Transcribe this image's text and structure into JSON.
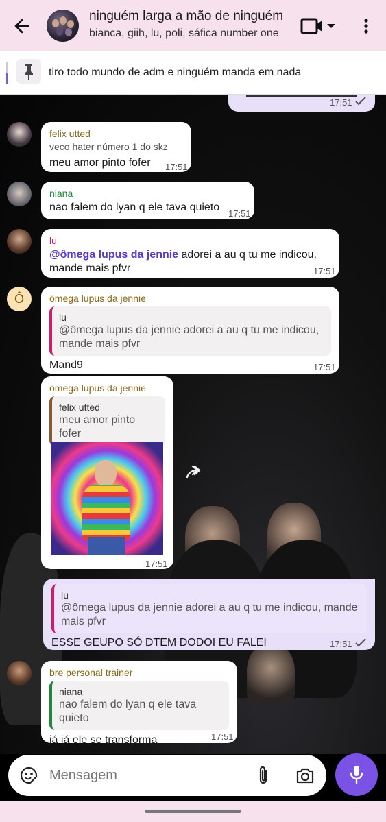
{
  "header": {
    "title": "ninguém larga a mão de ninguém",
    "subtitle": "bianca, giih, lu, poli, sáfica number one",
    "icons": [
      "back-arrow-icon",
      "video-call-icon",
      "chevron-down-icon",
      "more-vert-icon"
    ]
  },
  "pinned": {
    "text": "tiro todo mundo de adm e ninguém manda em nada"
  },
  "messages": {
    "m0": {
      "time": "17:51"
    },
    "m1": {
      "sender": "felix utted",
      "subline": "veco hater número 1 do skz",
      "text": "meu amor pinto fofer",
      "time": "17:51"
    },
    "m2": {
      "sender": "niana",
      "text": "nao falem do lyan q ele tava quieto",
      "time": "17:51"
    },
    "m3": {
      "sender": "lu",
      "mention": "@ômega lupus da jennie",
      "text": " adorei a au q tu me indicou, mande mais pfvr",
      "time": "17:51"
    },
    "m4": {
      "avatar_letter": "Ô",
      "sender": "ômega lupus da jennie",
      "quote_sender": "lu",
      "quote_text": "@ômega lupus da jennie adorei a au q tu me indicou, mande mais pfvr",
      "text": "Mand9",
      "time": "17:51"
    },
    "m5": {
      "sender": "ômega lupus da jennie",
      "quote_sender": "felix utted",
      "quote_text": "meu amor pinto fofer",
      "time": "17:51"
    },
    "m6": {
      "quote_sender": "lu",
      "quote_text": "@ômega lupus da jennie adorei a au q tu me indicou, mande mais pfvr",
      "text": "ESSE GEUPO SÓ DTEM DODOI EU FALEI",
      "time": "17:51"
    },
    "m7": {
      "sender": "bre personal trainer",
      "quote_sender": "niana",
      "quote_text": "nao falem do lyan q ele tava quieto",
      "text": "já já ele se transforma",
      "time": "17:51"
    }
  },
  "composer": {
    "placeholder": "Mensagem"
  },
  "colors": {
    "header_bg": "#f7e1ec",
    "accent": "#7b52e6",
    "outgoing_bubble": "#e8dff8"
  }
}
